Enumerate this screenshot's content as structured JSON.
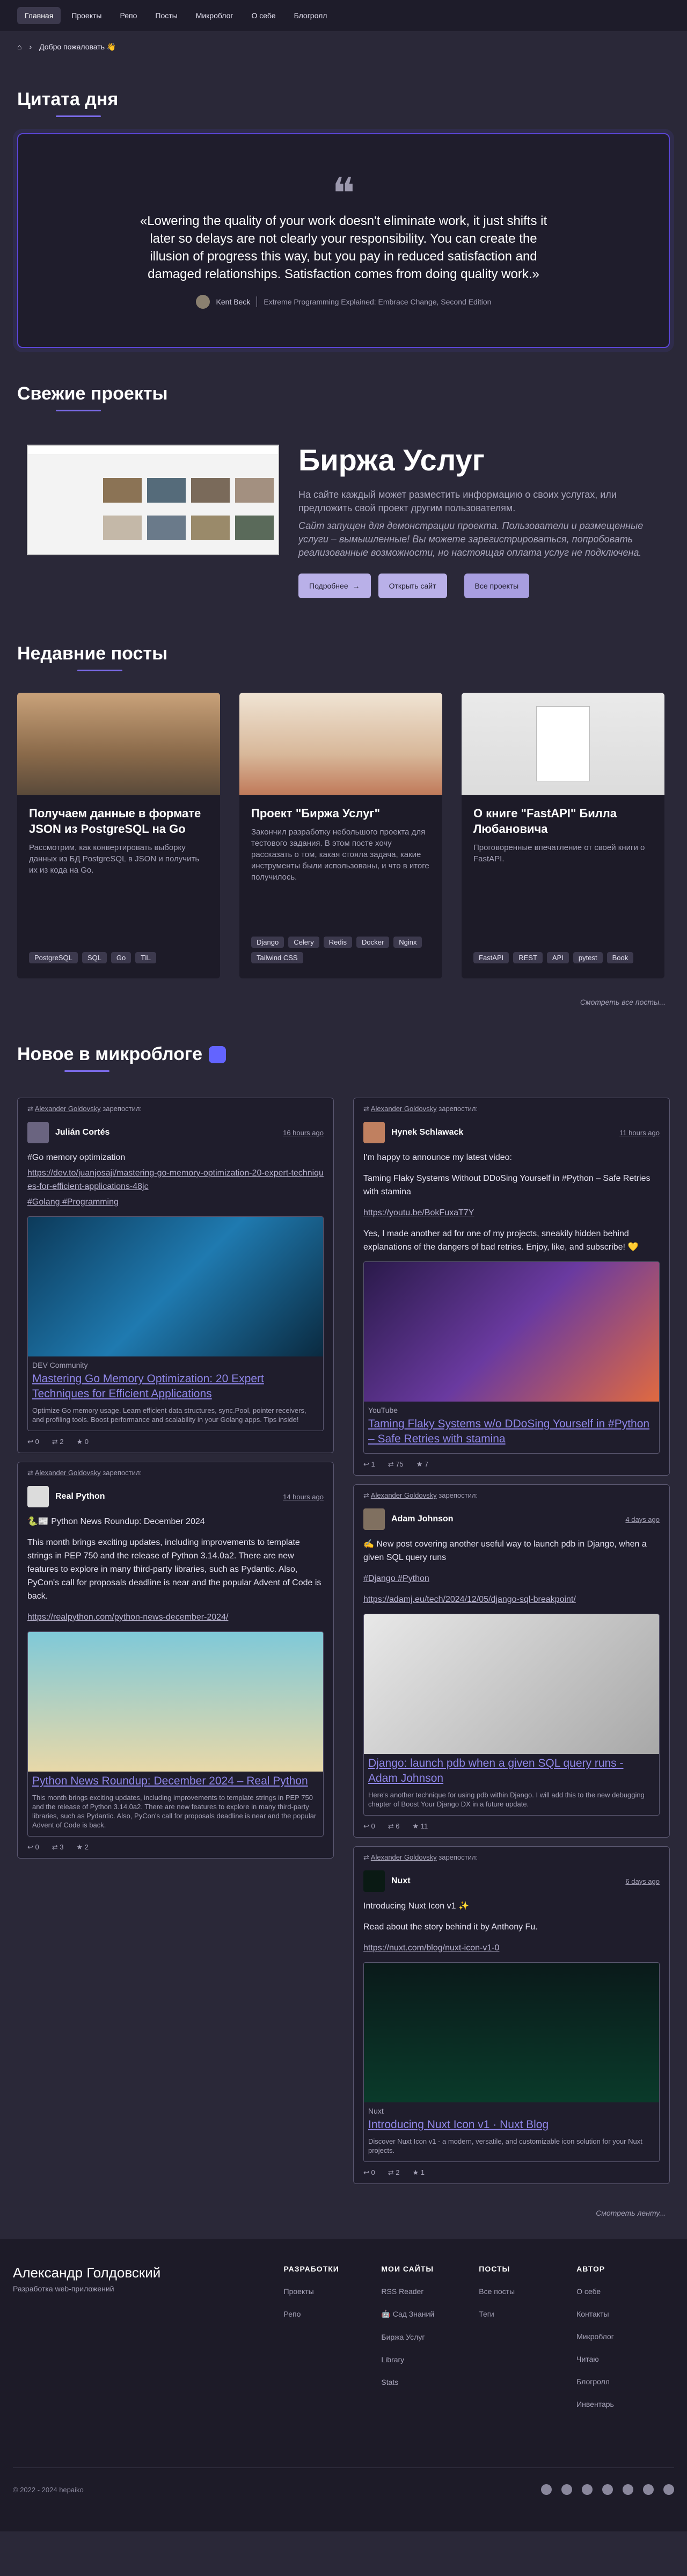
{
  "nav": {
    "items": [
      "Главная",
      "Проекты",
      "Репо",
      "Посты",
      "Микроблог",
      "О себе",
      "Блогролл"
    ]
  },
  "breadcrumb": {
    "current": "Добро пожаловать 👋"
  },
  "quote": {
    "section_title": "Цитата дня",
    "text": "«Lowering the quality of your work doesn't eliminate work, it just shifts it later so delays are not clearly your responsibility. You can create the illusion of progress this way, but you pay in reduced satisfaction and damaged relationships. Satisfaction comes from doing quality work.»",
    "author": "Kent Beck",
    "book": "Extreme Programming Explained: Embrace Change, Second Edition"
  },
  "projects": {
    "section_title": "Свежие проекты",
    "title": "Биржа Услуг",
    "desc": "На сайте каждый может разместить информацию о своих услугах, или предложить свой проект другим пользователям.",
    "note": "Сайт запущен для демонстрации проекта. Пользователи и размещенные услуги – вымышленные! Вы можете зарегистрироваться, попробовать реализованные возможности, но настоящая оплата услуг не подключена.",
    "btn_more": "Подробнее",
    "btn_open": "Открыть сайт",
    "btn_all": "Все проекты"
  },
  "posts": {
    "section_title": "Недавние посты",
    "items": [
      {
        "title": "Получаем данные в формате JSON из PostgreSQL на Go",
        "text": "Рассмотрим, как конвертировать выборку данных из БД PostgreSQL в JSON и получить их из кода на Go.",
        "tags": [
          "PostgreSQL",
          "SQL",
          "Go",
          "TIL"
        ]
      },
      {
        "title": "Проект \"Биржа Услуг\"",
        "text": "Закончил разработку небольшого проекта для тестового задания. В этом посте хочу рассказать о том, какая стояла задача, какие инструменты были использованы, и что в итоге получилось.",
        "tags": [
          "Django",
          "Celery",
          "Redis",
          "Docker",
          "Nginx",
          "Tailwind CSS"
        ]
      },
      {
        "title": "О книге \"FastAPI\" Билла Любановича",
        "text": "Проговоренные впечатление от своей книги о FastAPI.",
        "tags": [
          "FastAPI",
          "REST",
          "API",
          "pytest",
          "Book"
        ]
      }
    ],
    "all_link": "Смотреть все посты..."
  },
  "micro": {
    "section_title": "Новое в микроблоге",
    "reposter": "Alexander Goldovsky",
    "reposted": "зарепостил:",
    "left": [
      {
        "name": "Julián Cortés",
        "time": "16 hours ago",
        "body": "#Go memory optimization",
        "link": "https://dev.to/juanjosaji/mastering-go-memory-optimization-20-expert-techniques-for-efficient-applications-48jc",
        "tags_line": "#Golang #Programming",
        "src": "DEV Community",
        "title": "Mastering Go Memory Optimization: 20 Expert Techniques for Efficient Applications",
        "desc": "Optimize Go memory usage. Learn efficient data structures, sync.Pool, pointer receivers, and profiling tools. Boost performance and scalability in your Golang apps. Tips inside!",
        "stats": [
          "0",
          "2",
          "0"
        ]
      },
      {
        "name": "Real Python",
        "time": "14 hours ago",
        "body": "🐍📰 Python News Roundup: December 2024",
        "body2": "This month brings exciting updates, including improvements to template strings in PEP 750 and the release of Python 3.14.0a2. There are new features to explore in many third-party libraries, such as Pydantic. Also, PyCon's call for proposals deadline is near and the popular Advent of Code is back.",
        "link": "https://realpython.com/python-news-december-2024/",
        "src": "",
        "title": "Python News Roundup: December 2024 – Real Python",
        "desc": "This month brings exciting updates, including improvements to template strings in PEP 750 and the release of Python 3.14.0a2. There are new features to explore in many third-party libraries, such as Pydantic. Also, PyCon's call for proposals deadline is near and the popular Advent of Code is back.",
        "stats": [
          "0",
          "3",
          "2"
        ]
      }
    ],
    "right": [
      {
        "name": "Hynek Schlawack",
        "time": "11 hours ago",
        "body": "I'm happy to announce my latest video:",
        "body2": "Taming Flaky Systems Without DDoSing Yourself in #Python – Safe Retries with stamina",
        "link": "https://youtu.be/BokFuxaT7Y",
        "body3": "Yes, I made another ad for one of my projects, sneakily hidden behind explanations of the dangers of bad retries. Enjoy, like, and subscribe! 💛",
        "src": "YouTube",
        "title": "Taming Flaky Systems w/o DDoSing Yourself in #Python – Safe Retries with stamina",
        "desc": "",
        "stats": [
          "1",
          "75",
          "7"
        ]
      },
      {
        "name": "Adam Johnson",
        "time": "4 days ago",
        "body": "✍️ New post covering another useful way to launch pdb in Django, when a given SQL query runs",
        "tags_line": "#Django #Python",
        "link": "https://adamj.eu/tech/2024/12/05/django-sql-breakpoint/",
        "src": "",
        "title": "Django: launch pdb when a given SQL query runs - Adam Johnson",
        "desc": "Here's another technique for using pdb within Django. I will add this to the new debugging chapter of Boost Your Django DX in a future update.",
        "stats": [
          "0",
          "6",
          "11"
        ]
      },
      {
        "name": "Nuxt",
        "time": "6 days ago",
        "body": "Introducing Nuxt Icon v1 ✨",
        "body2": "Read about the story behind it by Anthony Fu.",
        "link": "https://nuxt.com/blog/nuxt-icon-v1-0",
        "src": "Nuxt",
        "title": "Introducing Nuxt Icon v1 · Nuxt Blog",
        "desc": "Discover Nuxt Icon v1 - a modern, versatile, and customizable icon solution for your Nuxt projects.",
        "stats": [
          "0",
          "2",
          "1"
        ]
      }
    ],
    "all_link": "Смотреть ленту..."
  },
  "footer": {
    "name": "Александр Голдовский",
    "sub": "Разработка web-приложений",
    "cols": [
      {
        "head": "РАЗРАБОТКИ",
        "links": [
          "Проекты",
          "Репо"
        ]
      },
      {
        "head": "МОИ САЙТЫ",
        "links": [
          "RSS Reader",
          "🤖 Сад Знаний",
          "Биржа Услуг",
          "Library",
          "Stats"
        ]
      },
      {
        "head": "ПОСТЫ",
        "links": [
          "Все посты",
          "Теги"
        ]
      },
      {
        "head": "АВТОР",
        "links": [
          "О себе",
          "Контакты",
          "Микроблог",
          "Читаю",
          "Блогролл",
          "Инвентарь"
        ]
      }
    ],
    "copyright": "© 2022 - 2024 hepaiko"
  }
}
